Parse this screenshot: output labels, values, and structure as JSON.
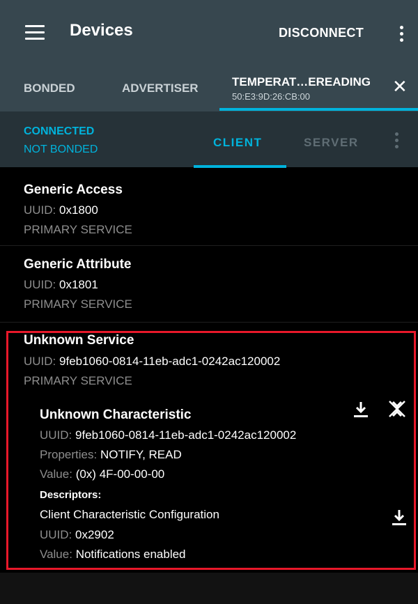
{
  "appbar": {
    "title": "Devices",
    "disconnect_label": "DISCONNECT"
  },
  "device_tabs": {
    "bonded": "BONDED",
    "advertiser": "ADVERTISER",
    "active_name": "TEMPERAT…EREADING",
    "active_address": "50:E3:9D:26:CB:00"
  },
  "connection": {
    "state": "CONNECTED",
    "bond": "NOT BONDED"
  },
  "view_tabs": {
    "client": "CLIENT",
    "server": "SERVER"
  },
  "services": [
    {
      "name": "Generic Access",
      "uuid_label": "UUID:",
      "uuid": "0x1800",
      "type": "PRIMARY SERVICE"
    },
    {
      "name": "Generic Attribute",
      "uuid_label": "UUID:",
      "uuid": "0x1801",
      "type": "PRIMARY SERVICE"
    },
    {
      "name": "Unknown Service",
      "uuid_label": "UUID:",
      "uuid": "9feb1060-0814-11eb-adc1-0242ac120002",
      "type": "PRIMARY SERVICE",
      "characteristic": {
        "name": "Unknown Characteristic",
        "uuid_label": "UUID:",
        "uuid": "9feb1060-0814-11eb-adc1-0242ac120002",
        "properties_label": "Properties:",
        "properties": "NOTIFY, READ",
        "value_label": "Value:",
        "value": "(0x) 4F-00-00-00",
        "descriptors_label": "Descriptors:",
        "descriptor": {
          "name": "Client Characteristic Configuration",
          "uuid_label": "UUID:",
          "uuid": "0x2902",
          "value_label": "Value:",
          "value": "Notifications enabled"
        }
      }
    }
  ],
  "colors": {
    "appbar": "#37474f",
    "subbar": "#263238",
    "accent": "#00b3dc",
    "highlight": "#e8182a"
  }
}
